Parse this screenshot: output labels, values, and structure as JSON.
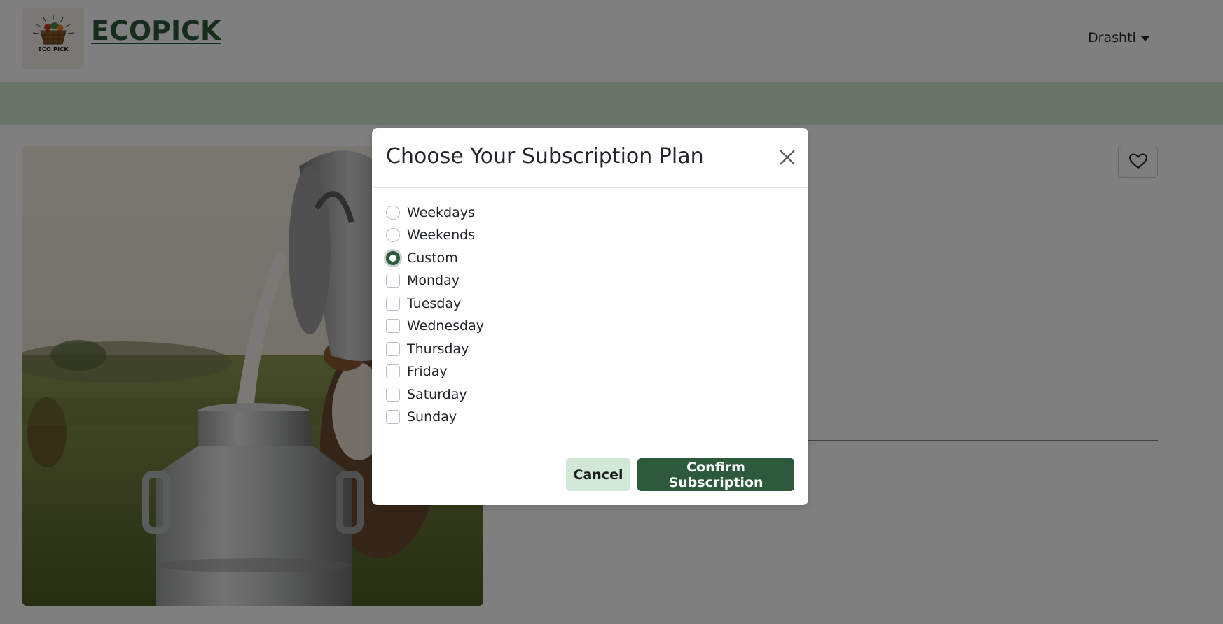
{
  "header": {
    "logo_text": "ECO PICK",
    "brand": "ECOPICK",
    "user_name": "Drashti"
  },
  "modal": {
    "title": "Choose Your Subscription Plan",
    "plans": [
      {
        "label": "Weekdays",
        "selected": false
      },
      {
        "label": "Weekends",
        "selected": false
      },
      {
        "label": "Custom",
        "selected": true
      }
    ],
    "days": [
      {
        "label": "Monday",
        "checked": false
      },
      {
        "label": "Tuesday",
        "checked": false
      },
      {
        "label": "Wednesday",
        "checked": false
      },
      {
        "label": "Thursday",
        "checked": false
      },
      {
        "label": "Friday",
        "checked": false
      },
      {
        "label": "Saturday",
        "checked": false
      },
      {
        "label": "Sunday",
        "checked": false
      }
    ],
    "cancel_label": "Cancel",
    "confirm_label": "Confirm Subscription"
  },
  "colors": {
    "brand_green": "#2d5a3d",
    "light_green": "#d2e8d6"
  }
}
